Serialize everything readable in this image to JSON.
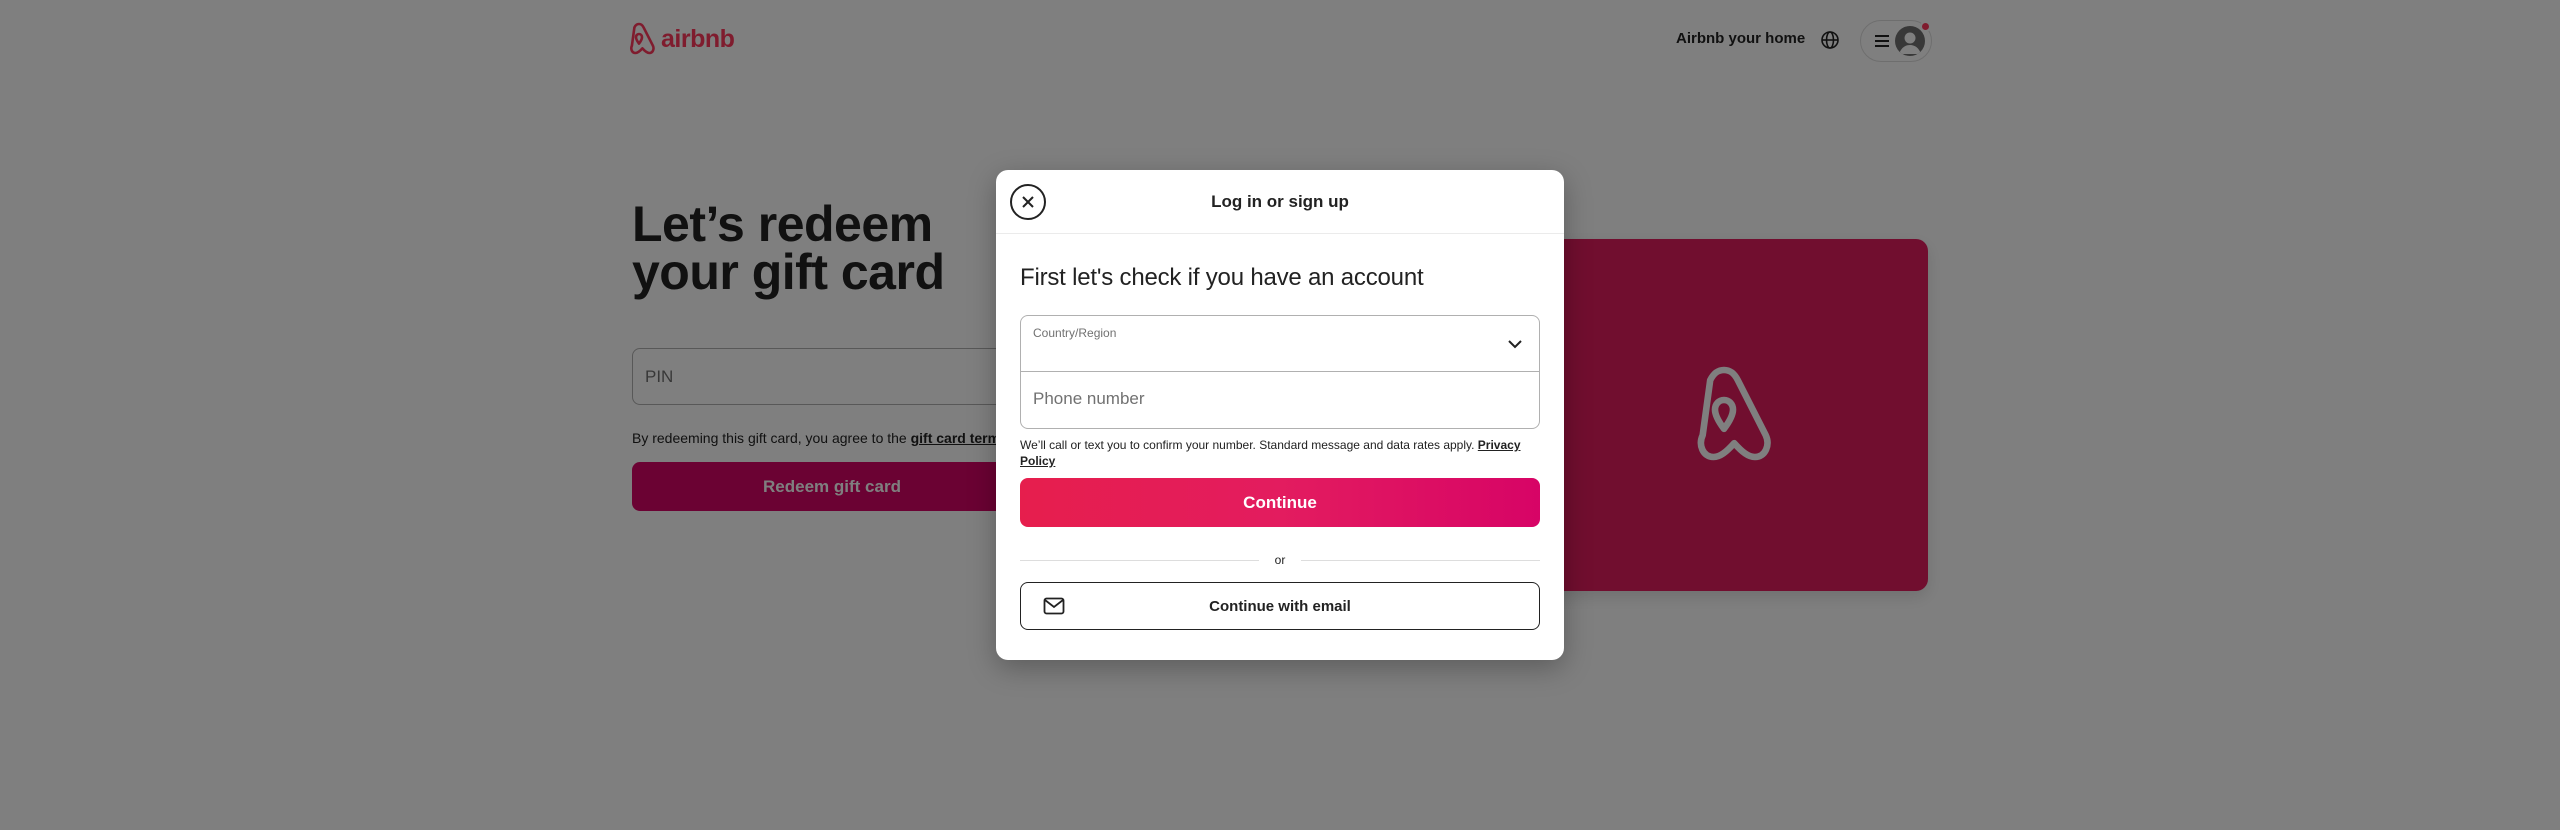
{
  "header": {
    "logo_text": "airbnb",
    "host_link": "Airbnb your home"
  },
  "page": {
    "title": "Let’s redeem your gift card",
    "pin_placeholder": "PIN",
    "terms_prefix": "By redeeming this gift card, you agree to the ",
    "terms_link": "gift card terms",
    "redeem_button": "Redeem gift card"
  },
  "modal": {
    "title": "Log in or sign up",
    "heading": "First let's check if you have an account",
    "country_label": "Country/Region",
    "country_value": "",
    "phone_placeholder": "Phone number",
    "notice_text": "We’ll call or text you to confirm your number. Standard message and data rates apply. ",
    "privacy_link": "Privacy Policy",
    "continue_button": "Continue",
    "divider_text": "or",
    "email_button": "Continue with email"
  },
  "colors": {
    "brand": "#ff385c",
    "primary_gradient_start": "#e61e4d",
    "primary_gradient_end": "#d70466",
    "card": "#e31c5f",
    "overlay": "rgba(0,0,0,0.5)"
  },
  "icons": {
    "logo": "airbnb-logo-icon",
    "globe": "globe-icon",
    "menu": "hamburger-menu-icon",
    "avatar": "user-avatar-icon",
    "close": "close-icon",
    "chevron": "chevron-down-icon",
    "mail": "envelope-icon",
    "card_logo": "airbnb-logo-icon"
  }
}
